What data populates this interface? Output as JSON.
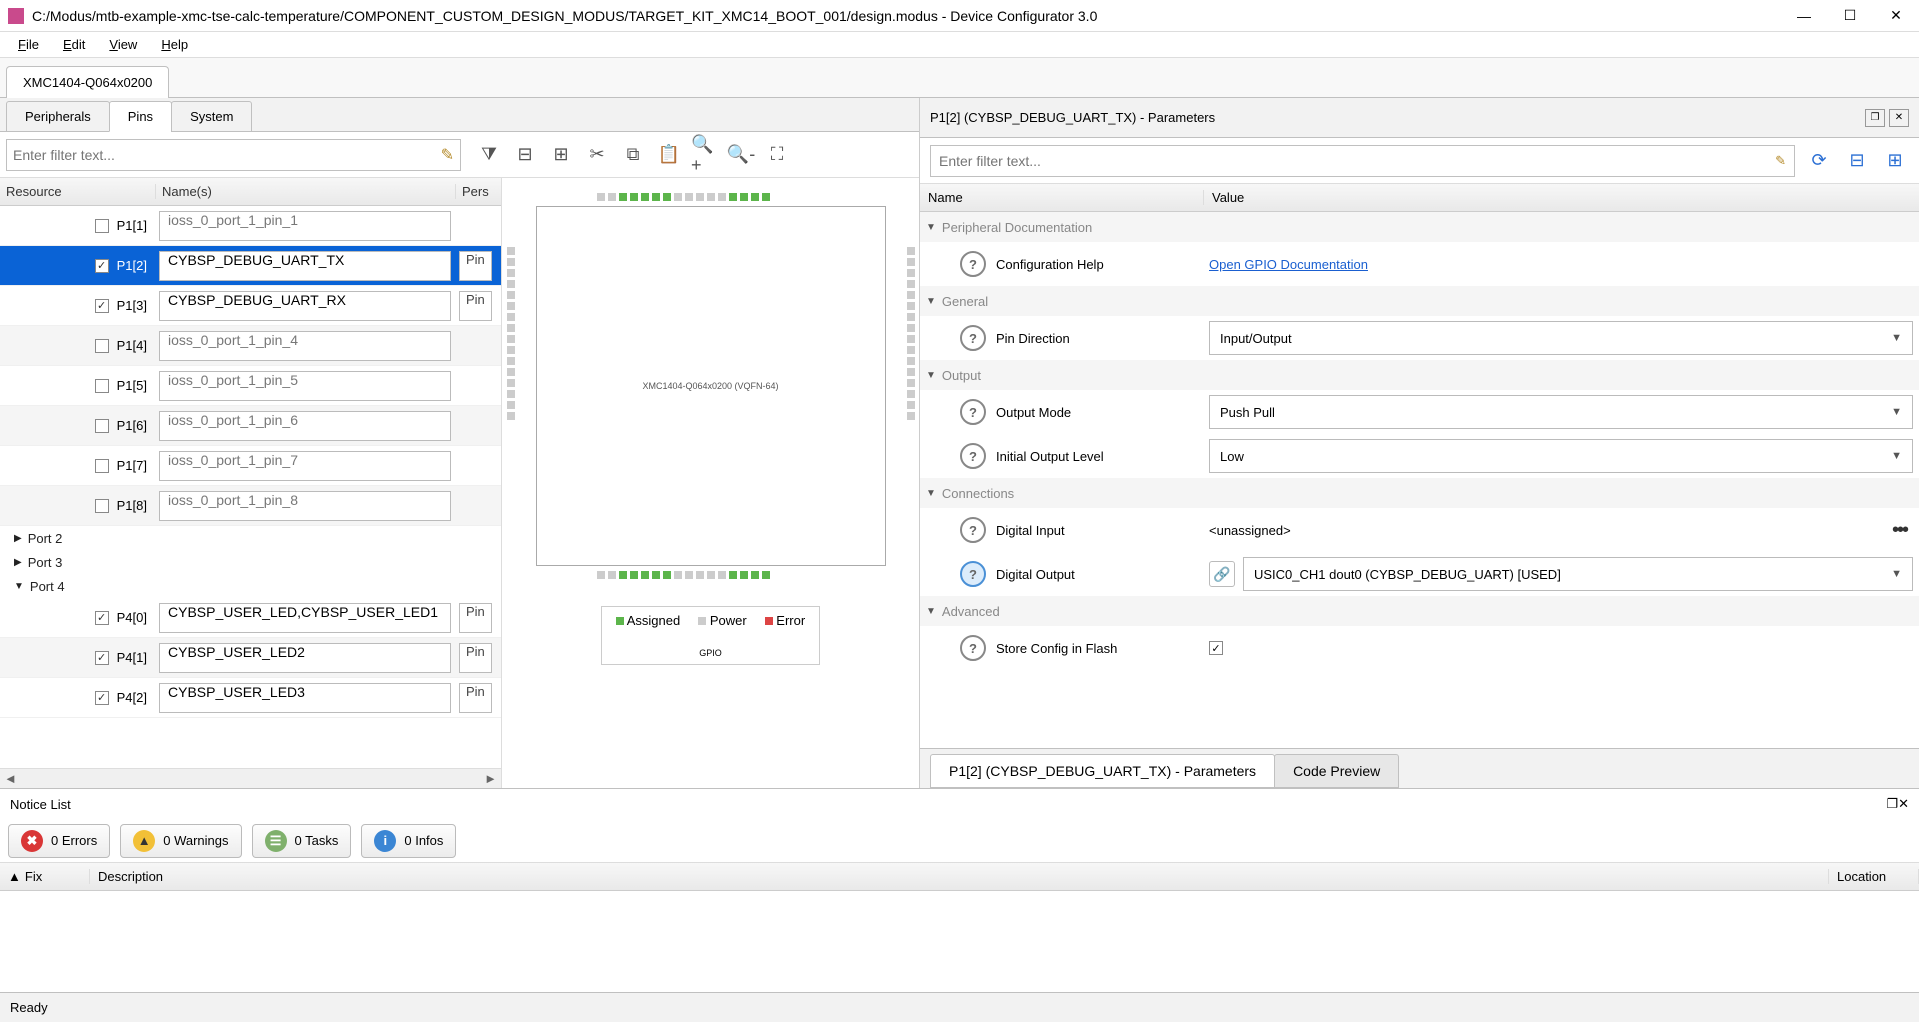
{
  "window": {
    "title": "C:/Modus/mtb-example-xmc-tse-calc-temperature/COMPONENT_CUSTOM_DESIGN_MODUS/TARGET_KIT_XMC14_BOOT_001/design.modus - Device Configurator 3.0"
  },
  "menu": {
    "file": "File",
    "edit": "Edit",
    "view": "View",
    "help": "Help"
  },
  "device_tab": "XMC1404-Q064x0200",
  "subtabs": {
    "peripherals": "Peripherals",
    "pins": "Pins",
    "system": "System"
  },
  "left_filter_placeholder": "Enter filter text...",
  "resource_headers": {
    "resource": "Resource",
    "names": "Name(s)",
    "personality": "Pers"
  },
  "pins": [
    {
      "id": "P1[1]",
      "checked": false,
      "name": "ioss_0_port_1_pin_1",
      "placeholder": true,
      "pers": "",
      "alt": false,
      "sel": false
    },
    {
      "id": "P1[2]",
      "checked": true,
      "name": "CYBSP_DEBUG_UART_TX",
      "placeholder": false,
      "pers": "Pin",
      "alt": true,
      "sel": true
    },
    {
      "id": "P1[3]",
      "checked": true,
      "name": "CYBSP_DEBUG_UART_RX",
      "placeholder": false,
      "pers": "Pin",
      "alt": false,
      "sel": false
    },
    {
      "id": "P1[4]",
      "checked": false,
      "name": "ioss_0_port_1_pin_4",
      "placeholder": true,
      "pers": "",
      "alt": true,
      "sel": false
    },
    {
      "id": "P1[5]",
      "checked": false,
      "name": "ioss_0_port_1_pin_5",
      "placeholder": true,
      "pers": "",
      "alt": false,
      "sel": false
    },
    {
      "id": "P1[6]",
      "checked": false,
      "name": "ioss_0_port_1_pin_6",
      "placeholder": true,
      "pers": "",
      "alt": true,
      "sel": false
    },
    {
      "id": "P1[7]",
      "checked": false,
      "name": "ioss_0_port_1_pin_7",
      "placeholder": true,
      "pers": "",
      "alt": false,
      "sel": false
    },
    {
      "id": "P1[8]",
      "checked": false,
      "name": "ioss_0_port_1_pin_8",
      "placeholder": true,
      "pers": "",
      "alt": true,
      "sel": false
    }
  ],
  "groups": {
    "port2": "Port 2",
    "port3": "Port 3",
    "port4": "Port 4"
  },
  "port4": [
    {
      "id": "P4[0]",
      "checked": true,
      "name": "CYBSP_USER_LED,CYBSP_USER_LED1",
      "pers": "Pin",
      "alt": false
    },
    {
      "id": "P4[1]",
      "checked": true,
      "name": "CYBSP_USER_LED2",
      "pers": "Pin",
      "alt": true
    },
    {
      "id": "P4[2]",
      "checked": true,
      "name": "CYBSP_USER_LED3",
      "pers": "Pin",
      "alt": false
    }
  ],
  "package_label": "XMC1404-Q064x0200 (VQFN-64)",
  "legend": {
    "assigned": "Assigned",
    "power": "Power",
    "error": "Error",
    "gpio": "GPIO"
  },
  "right_header": "P1[2] (CYBSP_DEBUG_UART_TX) - Parameters",
  "right_filter_placeholder": "Enter filter text...",
  "param_headers": {
    "name": "Name",
    "value": "Value"
  },
  "param_groups": {
    "doc": "Peripheral Documentation",
    "general": "General",
    "output": "Output",
    "connections": "Connections",
    "advanced": "Advanced"
  },
  "params": {
    "confighelp_label": "Configuration Help",
    "confighelp_link": "Open GPIO Documentation",
    "pindir_label": "Pin Direction",
    "pindir_value": "Input/Output",
    "outputmode_label": "Output Mode",
    "outputmode_value": "Push Pull",
    "initlevel_label": "Initial Output Level",
    "initlevel_value": "Low",
    "din_label": "Digital Input",
    "din_value": "<unassigned>",
    "dout_label": "Digital Output",
    "dout_value": "USIC0_CH1 dout0 (CYBSP_DEBUG_UART) [USED]",
    "store_label": "Store Config in Flash",
    "store_checked": true
  },
  "right_tabs": {
    "params": "P1[2] (CYBSP_DEBUG_UART_TX) - Parameters",
    "code": "Code Preview"
  },
  "notice": {
    "title": "Notice List",
    "errors": "0 Errors",
    "warnings": "0 Warnings",
    "tasks": "0 Tasks",
    "infos": "0 Infos",
    "col_fix": "Fix",
    "col_desc": "Description",
    "col_loc": "Location"
  },
  "status": "Ready"
}
